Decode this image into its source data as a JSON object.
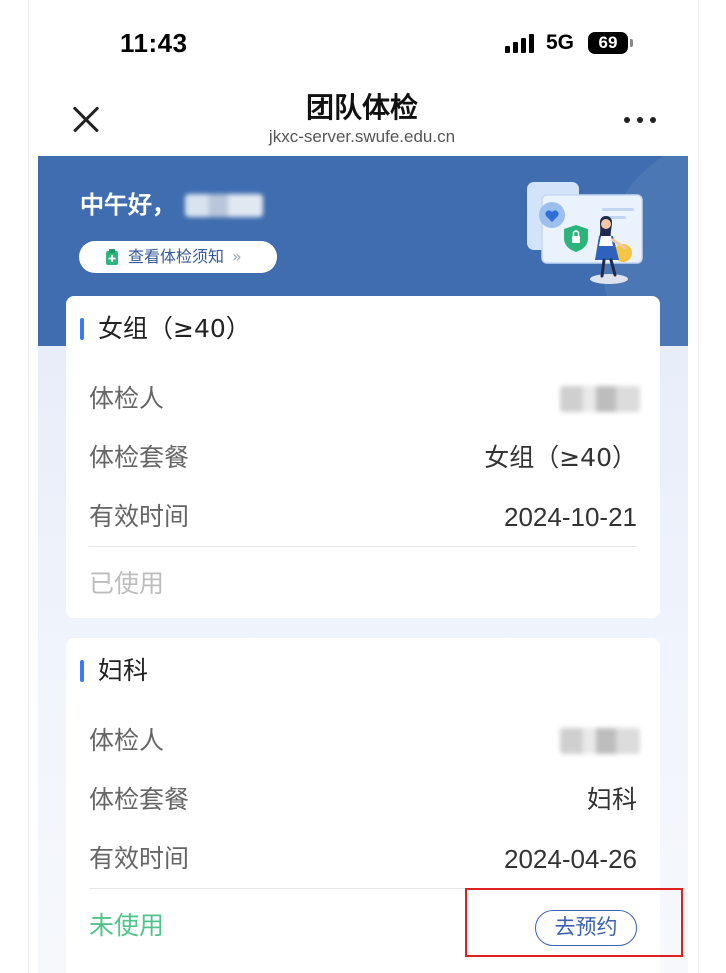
{
  "status_bar": {
    "time": "11:43",
    "network": "5G",
    "battery": "69",
    "icons": [
      "signal-icon",
      "battery-icon"
    ]
  },
  "nav": {
    "title": "团队体检",
    "subtitle": "jkxc-server.swufe.edu.cn",
    "icons": [
      "close-icon",
      "more-icon"
    ]
  },
  "banner": {
    "greeting": "中午好，",
    "notice_button": "查看体检须知",
    "notice_chevron": "»",
    "notice_icon": "clipboard-icon",
    "illustration": "checkup-illustration"
  },
  "cards": [
    {
      "title": "女组（≥40）",
      "rows": [
        {
          "label": "体检人"
        },
        {
          "label": "体检套餐",
          "value": "女组（≥40）"
        },
        {
          "label": "有效时间",
          "value": "2024-10-21"
        }
      ],
      "status": "已使用"
    },
    {
      "title": "妇科",
      "rows": [
        {
          "label": "体检人"
        },
        {
          "label": "体检套餐",
          "value": "妇科"
        },
        {
          "label": "有效时间",
          "value": "2024-04-26"
        }
      ],
      "status": "未使用",
      "action": "去预约"
    }
  ],
  "colors": {
    "banner": "#3f6db0",
    "accent": "#3a7bf2",
    "notice_text": "#35599a",
    "status_used": "#bdbdbd",
    "status_unused": "#52c48b",
    "action": "#3d62b4",
    "highlight": "#e02020"
  }
}
